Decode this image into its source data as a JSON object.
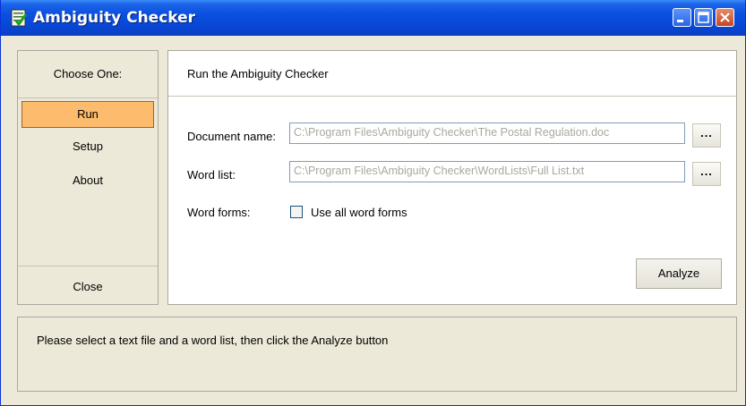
{
  "window": {
    "title": "Ambiguity Checker",
    "app_icon": "document-check-icon"
  },
  "title_buttons": {
    "minimize": "minimize-icon",
    "maximize": "maximize-icon",
    "close": "close-icon"
  },
  "sidebar": {
    "header": "Choose One:",
    "items": [
      {
        "label": "Run",
        "active": true
      },
      {
        "label": "Setup",
        "active": false
      },
      {
        "label": "About",
        "active": false
      }
    ],
    "close_label": "Close",
    "active_color": "#fdbb6e"
  },
  "main": {
    "title": "Run the Ambiguity Checker",
    "document_name": {
      "label": "Document name:",
      "value": "C:\\Program Files\\Ambiguity Checker\\The Postal Regulation.doc",
      "browse_label": "..."
    },
    "word_list": {
      "label": "Word list:",
      "value": "C:\\Program Files\\Ambiguity Checker\\WordLists\\Full List.txt",
      "browse_label": "..."
    },
    "word_forms": {
      "label": "Word forms:",
      "checkbox_label": "Use all word forms",
      "checked": false
    },
    "analyze_label": "Analyze"
  },
  "status": {
    "message": "Please select a text file and a word list, then click the Analyze button"
  }
}
